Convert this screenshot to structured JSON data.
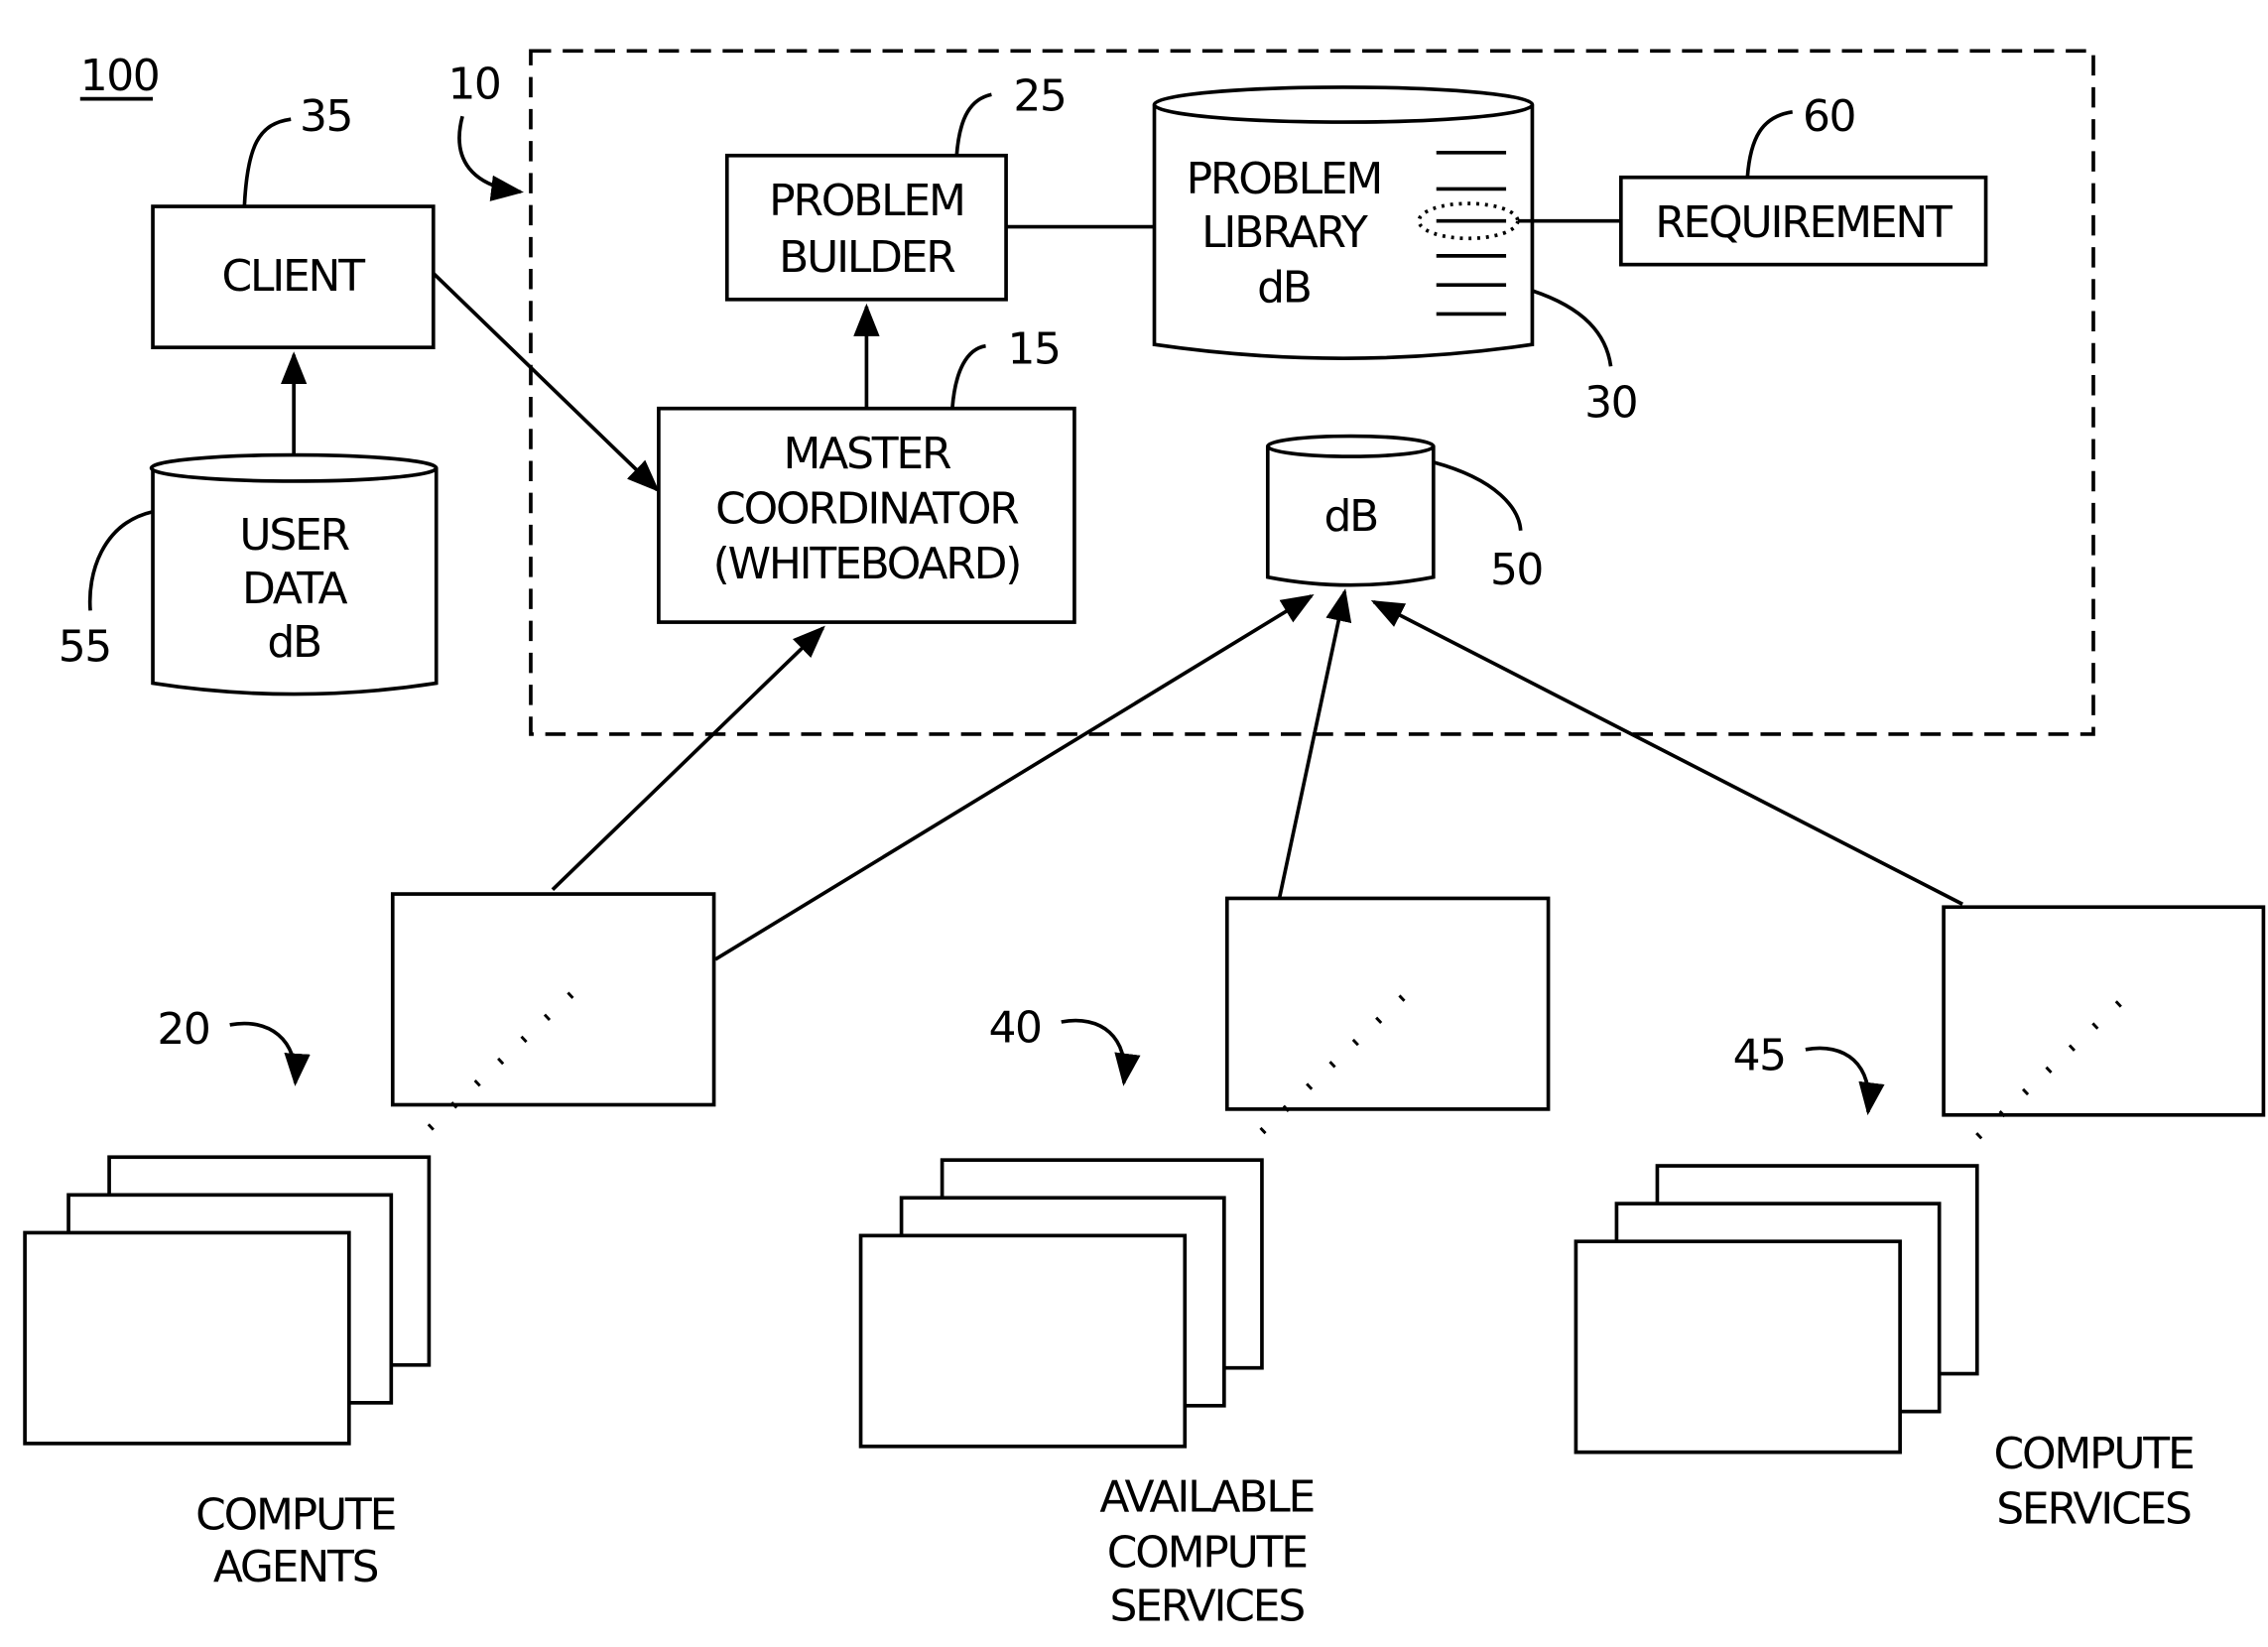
{
  "figure": {
    "number": "100",
    "system_ref": "10"
  },
  "client": {
    "label": "CLIENT",
    "ref": "35"
  },
  "user_db": {
    "lines": [
      "USER",
      "DATA",
      "dB"
    ],
    "ref": "55"
  },
  "problem_builder": {
    "lines": [
      "PROBLEM",
      "BUILDER"
    ],
    "ref": "25"
  },
  "master_coordinator": {
    "lines": [
      "MASTER",
      "COORDINATOR",
      "(WHITEBOARD)"
    ],
    "ref": "15"
  },
  "problem_library": {
    "lines": [
      "PROBLEM",
      "LIBRARY",
      "dB"
    ],
    "ref": "30"
  },
  "requirement": {
    "label": "REQUIREMENT",
    "ref": "60"
  },
  "db": {
    "label": "dB",
    "ref": "50"
  },
  "groups": [
    {
      "ref": "20",
      "lines": [
        "COMPUTE",
        "AGENTS"
      ]
    },
    {
      "ref": "40",
      "lines": [
        "AVAILABLE",
        "COMPUTE",
        "SERVICES"
      ]
    },
    {
      "ref": "45",
      "lines": [
        "COMPUTE",
        "SERVICES"
      ]
    }
  ]
}
